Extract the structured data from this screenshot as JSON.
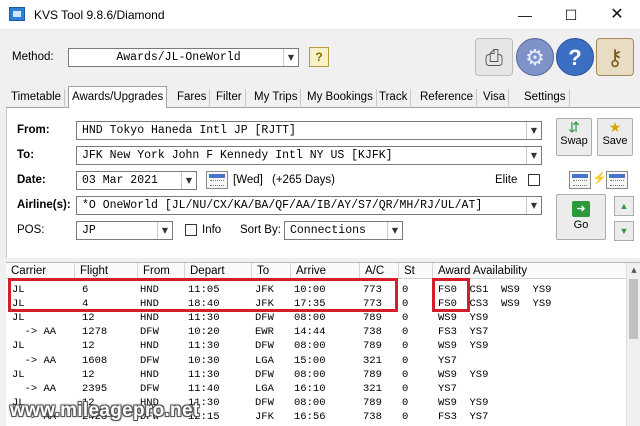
{
  "window": {
    "title": "KVS Tool 9.8.6/Diamond",
    "min": "—",
    "max": "☐",
    "close": "✕"
  },
  "method": {
    "label": "Method:",
    "value": "Awards/JL-OneWorld",
    "help": "?"
  },
  "tabs": [
    {
      "label": "Timetable"
    },
    {
      "label": "Awards/Upgrades",
      "active": true
    },
    {
      "label": "Fares"
    },
    {
      "label": "Filter"
    },
    {
      "label": "My Trips"
    },
    {
      "label": "My Bookings"
    },
    {
      "label": "Track"
    },
    {
      "label": "Reference"
    },
    {
      "label": "Visa"
    },
    {
      "label": "Settings"
    }
  ],
  "form": {
    "from_label": "From:",
    "from_value": "HND  Tokyo Haneda Intl JP [RJTT]",
    "to_label": "To:",
    "to_value": "JFK  New York John F Kennedy Intl NY US [KJFK]",
    "date_label": "Date:",
    "date_value": "03 Mar 2021",
    "day_text": "[Wed]",
    "days_ahead": "(+265 Days)",
    "elite_label": "Elite",
    "airlines_label": "Airline(s):",
    "airlines_value": "*O  OneWorld [JL/NU/CX/KA/BA/QF/AA/IB/AY/S7/QR/MH/RJ/UL/AT]",
    "pos_label": "POS:",
    "pos_value": "JP",
    "info_label": "Info",
    "sortby_label": "Sort By:",
    "sortby_value": "Connections"
  },
  "buttons": {
    "swap": "Swap",
    "save": "Save",
    "go": "Go"
  },
  "grid": {
    "headers": [
      "Carrier",
      "Flight",
      "From",
      "Depart",
      "To",
      "Arrive",
      "A/C",
      "St",
      "Award Availability"
    ],
    "rows": [
      [
        "JL",
        "6",
        "HND",
        "11:05",
        "JFK",
        "10:00",
        "773",
        "0",
        "FS0  CS1  WS9  YS9"
      ],
      [
        "JL",
        "4",
        "HND",
        "18:40",
        "JFK",
        "17:35",
        "773",
        "0",
        "FS0  CS3  WS9  YS9"
      ],
      [
        "JL",
        "12",
        "HND",
        "11:30",
        "DFW",
        "08:00",
        "789",
        "0",
        "WS9  YS9"
      ],
      [
        "  -> AA",
        "1278",
        "DFW",
        "10:20",
        "EWR",
        "14:44",
        "738",
        "0",
        "FS3  YS7"
      ],
      [
        "JL",
        "12",
        "HND",
        "11:30",
        "DFW",
        "08:00",
        "789",
        "0",
        "WS9  YS9"
      ],
      [
        "  -> AA",
        "1608",
        "DFW",
        "10:30",
        "LGA",
        "15:00",
        "321",
        "0",
        "YS7"
      ],
      [
        "JL",
        "12",
        "HND",
        "11:30",
        "DFW",
        "08:00",
        "789",
        "0",
        "WS9  YS9"
      ],
      [
        "  -> AA",
        "2395",
        "DFW",
        "11:40",
        "LGA",
        "16:10",
        "321",
        "0",
        "YS7"
      ],
      [
        "JL",
        "12",
        "HND",
        "11:30",
        "DFW",
        "08:00",
        "789",
        "0",
        "WS9  YS9"
      ],
      [
        "  -> AA",
        "2423",
        "DFW",
        "12:15",
        "JFK",
        "16:56",
        "738",
        "0",
        "FS3  YS7"
      ]
    ]
  },
  "watermark": "www.mileagepro.net",
  "colors": {
    "highlight": "#d21f2a",
    "accent": "#2a9a3a"
  }
}
